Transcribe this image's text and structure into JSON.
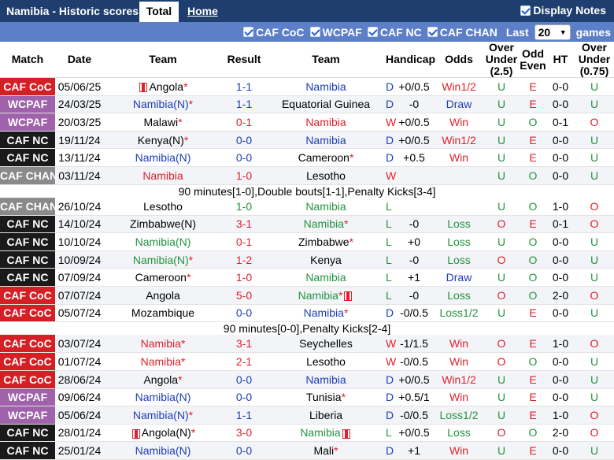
{
  "header": {
    "title": "Namibia - Historic scores",
    "tab_total": "Total",
    "tab_home": "Home",
    "display_notes": "Display Notes"
  },
  "filters": {
    "items": [
      "CAF CoC",
      "WCPAF",
      "CAF NC",
      "CAF CHAN"
    ],
    "last_label": "Last",
    "last_value": "20",
    "games_label": "games"
  },
  "columns": {
    "match": "Match",
    "date": "Date",
    "team": "Team",
    "result": "Result",
    "team2": "Team",
    "handicap": "Handicap",
    "odds": "Odds",
    "over_under": "Over Under (2.5)",
    "odd_even": "Odd Even",
    "ht": "HT",
    "over_under2": "Over Under (0.75)"
  },
  "colors": {
    "caf_coc": "#d41f25",
    "wcpaf": "#a062aa",
    "caf_nc": "#1a1a1a",
    "caf_chan": "#8a8a8a",
    "win": "#e0202a",
    "draw": "#1e3db8",
    "loss": "#22943e",
    "namibia": "#e0202a",
    "header_bar": "#1d3e6e",
    "filter_bar": "#5c7fc8"
  },
  "rows": [
    {
      "comp": "CAF CoC",
      "ctype": "caf_coc",
      "date": "05/06/25",
      "home": "Angola",
      "hstar": "*",
      "hflag": true,
      "hc": "",
      "score": "1-1",
      "sc": "dblue",
      "away": "Namibia",
      "astar": "",
      "aflag": false,
      "ac": "dblue",
      "res": "D",
      "rc": "dblue",
      "hcap": "+0/0.5",
      "odds": "Win1/2",
      "oc": "red",
      "ou": "U",
      "ouc": "green",
      "oe": "E",
      "oec": "red",
      "ht": "0-0",
      "ou2": "U",
      "ou2c": "green"
    },
    {
      "comp": "WCPAF",
      "ctype": "wcpaf",
      "date": "24/03/25",
      "home": "Namibia(N)",
      "hstar": "*",
      "hflag": false,
      "hc": "dblue",
      "score": "1-1",
      "sc": "dblue",
      "away": "Equatorial Guinea",
      "astar": "",
      "aflag": false,
      "ac": "",
      "res": "D",
      "rc": "dblue",
      "hcap": "-0",
      "odds": "Draw",
      "oc": "dblue",
      "ou": "U",
      "ouc": "green",
      "oe": "E",
      "oec": "red",
      "ht": "0-0",
      "ou2": "U",
      "ou2c": "green"
    },
    {
      "comp": "WCPAF",
      "ctype": "wcpaf",
      "date": "20/03/25",
      "home": "Malawi",
      "hstar": "*",
      "hflag": false,
      "hc": "",
      "score": "0-1",
      "sc": "red",
      "away": "Namibia",
      "astar": "",
      "aflag": false,
      "ac": "red",
      "res": "W",
      "rc": "red",
      "hcap": "+0/0.5",
      "odds": "Win",
      "oc": "red",
      "ou": "U",
      "ouc": "green",
      "oe": "O",
      "oec": "green",
      "ht": "0-1",
      "ou2": "O",
      "ou2c": "red"
    },
    {
      "comp": "CAF NC",
      "ctype": "caf_nc",
      "date": "19/11/24",
      "home": "Kenya(N)",
      "hstar": "*",
      "hflag": false,
      "hc": "",
      "score": "0-0",
      "sc": "dblue",
      "away": "Namibia",
      "astar": "",
      "aflag": false,
      "ac": "dblue",
      "res": "D",
      "rc": "dblue",
      "hcap": "+0/0.5",
      "odds": "Win1/2",
      "oc": "red",
      "ou": "U",
      "ouc": "green",
      "oe": "E",
      "oec": "red",
      "ht": "0-0",
      "ou2": "U",
      "ou2c": "green"
    },
    {
      "comp": "CAF NC",
      "ctype": "caf_nc",
      "date": "13/11/24",
      "home": "Namibia(N)",
      "hstar": "",
      "hflag": false,
      "hc": "dblue",
      "score": "0-0",
      "sc": "dblue",
      "away": "Cameroon",
      "astar": "*",
      "aflag": false,
      "ac": "",
      "res": "D",
      "rc": "dblue",
      "hcap": "+0.5",
      "odds": "Win",
      "oc": "red",
      "ou": "U",
      "ouc": "green",
      "oe": "E",
      "oec": "red",
      "ht": "0-0",
      "ou2": "U",
      "ou2c": "green"
    },
    {
      "comp": "CAF CHAN",
      "ctype": "caf_chan",
      "date": "03/11/24",
      "home": "Namibia",
      "hstar": "",
      "hflag": false,
      "hc": "red",
      "score": "1-0",
      "sc": "red",
      "away": "Lesotho",
      "astar": "",
      "aflag": false,
      "ac": "",
      "res": "W",
      "rc": "red",
      "hcap": "",
      "odds": "",
      "oc": "",
      "ou": "U",
      "ouc": "green",
      "oe": "O",
      "oec": "green",
      "ht": "0-0",
      "ou2": "U",
      "ou2c": "green",
      "note": "90 minutes[1-0],Double bouts[1-1],Penalty Kicks[3-4]"
    },
    {
      "comp": "CAF CHAN",
      "ctype": "caf_chan",
      "date": "26/10/24",
      "home": "Lesotho",
      "hstar": "",
      "hflag": false,
      "hc": "",
      "score": "1-0",
      "sc": "green",
      "away": "Namibia",
      "astar": "",
      "aflag": false,
      "ac": "green",
      "res": "L",
      "rc": "green",
      "hcap": "",
      "odds": "",
      "oc": "",
      "ou": "U",
      "ouc": "green",
      "oe": "O",
      "oec": "green",
      "ht": "1-0",
      "ou2": "O",
      "ou2c": "red"
    },
    {
      "comp": "CAF NC",
      "ctype": "caf_nc",
      "date": "14/10/24",
      "home": "Zimbabwe(N)",
      "hstar": "",
      "hflag": false,
      "hc": "",
      "score": "3-1",
      "sc": "red",
      "away": "Namibia",
      "astar": "*",
      "aflag": false,
      "ac": "green",
      "res": "L",
      "rc": "green",
      "hcap": "-0",
      "odds": "Loss",
      "oc": "green",
      "ou": "O",
      "ouc": "red",
      "oe": "E",
      "oec": "red",
      "ht": "0-1",
      "ou2": "O",
      "ou2c": "red"
    },
    {
      "comp": "CAF NC",
      "ctype": "caf_nc",
      "date": "10/10/24",
      "home": "Namibia(N)",
      "hstar": "",
      "hflag": false,
      "hc": "green",
      "score": "0-1",
      "sc": "red",
      "away": "Zimbabwe",
      "astar": "*",
      "aflag": false,
      "ac": "",
      "res": "L",
      "rc": "green",
      "hcap": "+0",
      "odds": "Loss",
      "oc": "green",
      "ou": "U",
      "ouc": "green",
      "oe": "O",
      "oec": "green",
      "ht": "0-0",
      "ou2": "U",
      "ou2c": "green"
    },
    {
      "comp": "CAF NC",
      "ctype": "caf_nc",
      "date": "10/09/24",
      "home": "Namibia(N)",
      "hstar": "*",
      "hflag": false,
      "hc": "green",
      "score": "1-2",
      "sc": "red",
      "away": "Kenya",
      "astar": "",
      "aflag": false,
      "ac": "",
      "res": "L",
      "rc": "green",
      "hcap": "-0",
      "odds": "Loss",
      "oc": "green",
      "ou": "O",
      "ouc": "red",
      "oe": "O",
      "oec": "green",
      "ht": "0-0",
      "ou2": "U",
      "ou2c": "green"
    },
    {
      "comp": "CAF NC",
      "ctype": "caf_nc",
      "date": "07/09/24",
      "home": "Cameroon",
      "hstar": "*",
      "hflag": false,
      "hc": "",
      "score": "1-0",
      "sc": "red",
      "away": "Namibia",
      "astar": "",
      "aflag": false,
      "ac": "green",
      "res": "L",
      "rc": "green",
      "hcap": "+1",
      "odds": "Draw",
      "oc": "dblue",
      "ou": "U",
      "ouc": "green",
      "oe": "O",
      "oec": "green",
      "ht": "0-0",
      "ou2": "U",
      "ou2c": "green"
    },
    {
      "comp": "CAF CoC",
      "ctype": "caf_coc",
      "date": "07/07/24",
      "home": "Angola",
      "hstar": "",
      "hflag": false,
      "hc": "",
      "score": "5-0",
      "sc": "red",
      "away": "Namibia",
      "astar": "*",
      "aflag": true,
      "ac": "green",
      "res": "L",
      "rc": "green",
      "hcap": "-0",
      "odds": "Loss",
      "oc": "green",
      "ou": "O",
      "ouc": "red",
      "oe": "O",
      "oec": "green",
      "ht": "2-0",
      "ou2": "O",
      "ou2c": "red"
    },
    {
      "comp": "CAF CoC",
      "ctype": "caf_coc",
      "date": "05/07/24",
      "home": "Mozambique",
      "hstar": "",
      "hflag": false,
      "hc": "",
      "score": "0-0",
      "sc": "dblue",
      "away": "Namibia",
      "astar": "*",
      "aflag": false,
      "ac": "dblue",
      "res": "D",
      "rc": "dblue",
      "hcap": "-0/0.5",
      "odds": "Loss1/2",
      "oc": "green",
      "ou": "U",
      "ouc": "green",
      "oe": "E",
      "oec": "red",
      "ht": "0-0",
      "ou2": "U",
      "ou2c": "green",
      "note": "90 minutes[0-0],Penalty Kicks[2-4]"
    },
    {
      "comp": "CAF CoC",
      "ctype": "caf_coc",
      "date": "03/07/24",
      "home": "Namibia",
      "hstar": "*",
      "hflag": false,
      "hc": "red",
      "score": "3-1",
      "sc": "red",
      "away": "Seychelles",
      "astar": "",
      "aflag": false,
      "ac": "",
      "res": "W",
      "rc": "red",
      "hcap": "-1/1.5",
      "odds": "Win",
      "oc": "red",
      "ou": "O",
      "ouc": "red",
      "oe": "E",
      "oec": "red",
      "ht": "1-0",
      "ou2": "O",
      "ou2c": "red"
    },
    {
      "comp": "CAF CoC",
      "ctype": "caf_coc",
      "date": "01/07/24",
      "home": "Namibia",
      "hstar": "*",
      "hflag": false,
      "hc": "red",
      "score": "2-1",
      "sc": "red",
      "away": "Lesotho",
      "astar": "",
      "aflag": false,
      "ac": "",
      "res": "W",
      "rc": "red",
      "hcap": "-0/0.5",
      "odds": "Win",
      "oc": "red",
      "ou": "O",
      "ouc": "red",
      "oe": "O",
      "oec": "green",
      "ht": "0-0",
      "ou2": "U",
      "ou2c": "green"
    },
    {
      "comp": "CAF CoC",
      "ctype": "caf_coc",
      "date": "28/06/24",
      "home": "Angola",
      "hstar": "*",
      "hflag": false,
      "hc": "",
      "score": "0-0",
      "sc": "dblue",
      "away": "Namibia",
      "astar": "",
      "aflag": false,
      "ac": "dblue",
      "res": "D",
      "rc": "dblue",
      "hcap": "+0/0.5",
      "odds": "Win1/2",
      "oc": "red",
      "ou": "U",
      "ouc": "green",
      "oe": "E",
      "oec": "red",
      "ht": "0-0",
      "ou2": "U",
      "ou2c": "green"
    },
    {
      "comp": "WCPAF",
      "ctype": "wcpaf",
      "date": "09/06/24",
      "home": "Namibia(N)",
      "hstar": "",
      "hflag": false,
      "hc": "dblue",
      "score": "0-0",
      "sc": "dblue",
      "away": "Tunisia",
      "astar": "*",
      "aflag": false,
      "ac": "",
      "res": "D",
      "rc": "dblue",
      "hcap": "+0.5/1",
      "odds": "Win",
      "oc": "red",
      "ou": "U",
      "ouc": "green",
      "oe": "E",
      "oec": "red",
      "ht": "0-0",
      "ou2": "U",
      "ou2c": "green"
    },
    {
      "comp": "WCPAF",
      "ctype": "wcpaf",
      "date": "05/06/24",
      "home": "Namibia(N)",
      "hstar": "*",
      "hflag": false,
      "hc": "dblue",
      "score": "1-1",
      "sc": "dblue",
      "away": "Liberia",
      "astar": "",
      "aflag": false,
      "ac": "",
      "res": "D",
      "rc": "dblue",
      "hcap": "-0/0.5",
      "odds": "Loss1/2",
      "oc": "green",
      "ou": "U",
      "ouc": "green",
      "oe": "E",
      "oec": "red",
      "ht": "1-0",
      "ou2": "O",
      "ou2c": "red"
    },
    {
      "comp": "CAF NC",
      "ctype": "caf_nc",
      "date": "28/01/24",
      "home": "Angola(N)",
      "hstar": "*",
      "hflag": true,
      "hc": "",
      "score": "3-0",
      "sc": "red",
      "away": "Namibia",
      "astar": "",
      "aflag": true,
      "ac": "green",
      "res": "L",
      "rc": "green",
      "hcap": "+0/0.5",
      "odds": "Loss",
      "oc": "green",
      "ou": "O",
      "ouc": "red",
      "oe": "O",
      "oec": "green",
      "ht": "2-0",
      "ou2": "O",
      "ou2c": "red"
    },
    {
      "comp": "CAF NC",
      "ctype": "caf_nc",
      "date": "25/01/24",
      "home": "Namibia(N)",
      "hstar": "",
      "hflag": false,
      "hc": "dblue",
      "score": "0-0",
      "sc": "dblue",
      "away": "Mali",
      "astar": "*",
      "aflag": false,
      "ac": "",
      "res": "D",
      "rc": "dblue",
      "hcap": "+1",
      "odds": "Win",
      "oc": "red",
      "ou": "U",
      "ouc": "green",
      "oe": "E",
      "oec": "red",
      "ht": "0-0",
      "ou2": "U",
      "ou2c": "green"
    }
  ]
}
